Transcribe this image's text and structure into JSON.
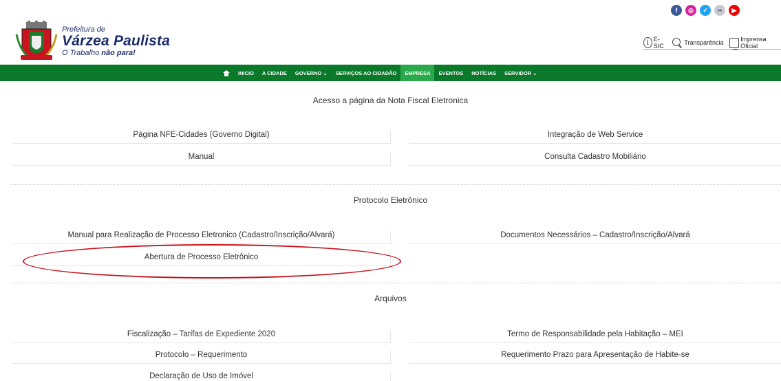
{
  "header": {
    "logo": {
      "small": "Prefeitura de",
      "main": "Várzea Paulista",
      "tagline_prefix": "O Trabalho",
      "tagline_bold": "não para!"
    },
    "social": [
      "facebook-icon",
      "instagram-icon",
      "twitter-icon",
      "flickr-icon",
      "youtube-icon"
    ],
    "toplinks": {
      "esic": "E-SIC",
      "transparencia": "Transparência",
      "imprensa": "Imprensa Oficial"
    }
  },
  "nav": {
    "items": [
      "INICIO",
      "A CIDADE",
      "GOVERNO ⌄",
      "SERVIÇOS AO CIDADÃO",
      "EMPRESA",
      "EVENTOS",
      "NOTÍCIAS",
      "SERVIDOR ⌄"
    ],
    "active": "EMPRESA"
  },
  "sections": {
    "nfe": {
      "title": "Acesso a página da Nota Fiscal Eletronica",
      "links": [
        "Página NFE-Cidades (Governo Digital)",
        "Integração de Web Service",
        "Manual",
        "Consulta Cadastro Mobiliário"
      ]
    },
    "protocolo": {
      "title": "Protocolo Eletrônico",
      "links": [
        "Manual para Realização de Processo Eletronico (Cadastro/Inscrição/Alvará)",
        "Documentos Necessários – Cadastro/Inscrição/Alvará",
        "Abertura de Processo Eletrônico"
      ]
    },
    "arquivos": {
      "title": "Arquivos",
      "links": [
        "Fiscalização – Tarifas de Expediente 2020",
        "Termo de Responsabilidade pela Habitação – MEI",
        "Protocolo – Requerimento",
        "Requerimento Prazo para Apresentação de Habite-se",
        "Declaração de Uso de Imóvel"
      ]
    }
  },
  "colors": {
    "nav_bg": "#0a7a2a",
    "nav_active": "#2aa94a",
    "highlight_ellipse": "#c8141e",
    "logo_text": "#1a2c6b"
  }
}
